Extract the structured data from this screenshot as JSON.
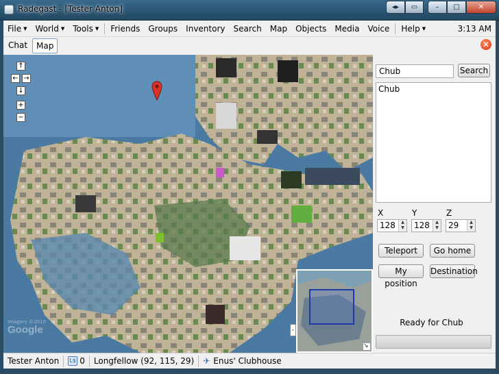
{
  "window": {
    "title": "Radegast - [Tester Anton]",
    "controls": [
      "◂▸",
      "▭",
      "–",
      "□",
      "✕"
    ]
  },
  "menu": {
    "file": "File",
    "world": "World",
    "tools": "Tools",
    "friends": "Friends",
    "groups": "Groups",
    "inventory": "Inventory",
    "search": "Search",
    "map": "Map",
    "objects": "Objects",
    "media": "Media",
    "voice": "Voice",
    "help": "Help",
    "clock": "3:13 AM"
  },
  "tabs": {
    "chat": "Chat",
    "map": "Map"
  },
  "map": {
    "nav": {
      "up": "↑",
      "left": "←",
      "right": "→",
      "down": "↓",
      "zoom_in": "+",
      "zoom_out": "−"
    },
    "watermark": "Google",
    "watermark_small": "Imagery ©2010",
    "minimap_toggle": "‹",
    "resize_glyph": "↘"
  },
  "panel": {
    "search_value": "Chub",
    "search_button": "Search",
    "results": [
      "Chub"
    ],
    "x_label": "X",
    "y_label": "Y",
    "z_label": "Z",
    "x_value": "128",
    "y_value": "128",
    "z_value": "29",
    "teleport": "Teleport",
    "go_home": "Go home",
    "my_position": "My position",
    "destination": "Destination",
    "status": "Ready for Chub"
  },
  "statusbar": {
    "user": "Tester Anton",
    "count": "0",
    "region": "Longfellow (92, 115, 29)",
    "parcel": "Enus' Clubhouse"
  },
  "colors": {
    "water": "#4a7aa2",
    "land": "#c9b89a",
    "pin": "#d9332a"
  }
}
